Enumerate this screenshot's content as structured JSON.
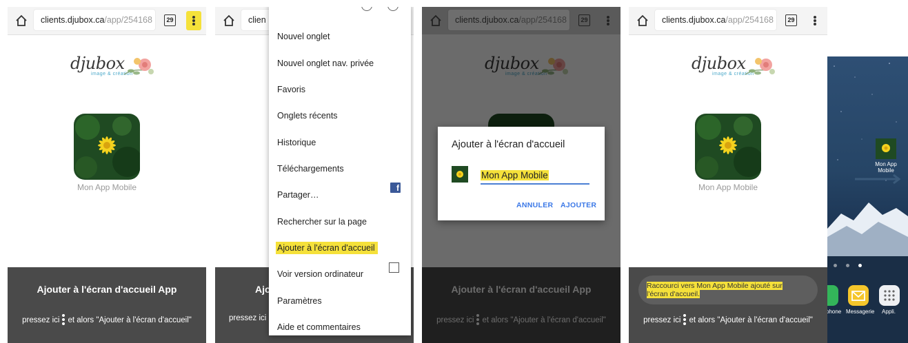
{
  "chrome": {
    "url_host": "clients.djubox.ca",
    "url_path": "/app/254168",
    "tabs_count": "29"
  },
  "page": {
    "logo_word": "djubox",
    "logo_tagline": "image & création",
    "app_name": "Mon App Mobile",
    "banner_title": "Ajouter à l'écran d'accueil App",
    "banner_instruction_prefix": "pressez ici",
    "banner_instruction_suffix": "et alors \"Ajouter à l'écran d'accueil\"",
    "banner_title_partial": "Ajo",
    "banner_url_partial": "clien"
  },
  "menu": {
    "items": [
      "Nouvel onglet",
      "Nouvel onglet nav. privée",
      "Favoris",
      "Onglets récents",
      "Historique",
      "Téléchargements",
      "Partager…",
      "Rechercher sur la page",
      "Ajouter à l'écran d'accueil",
      "Voir version ordinateur",
      "Paramètres",
      "Aide et commentaires"
    ],
    "highlighted": "Ajouter à l'écran d'accueil"
  },
  "dialog": {
    "title": "Ajouter à l'écran d'accueil",
    "input_value": "Mon App Mobile",
    "cancel_label": "ANNULER",
    "add_label": "AJOUTER"
  },
  "toast": {
    "text": "Raccourci vers Mon App Mobile ajouté sur l'écran d'accueil."
  },
  "homescreen": {
    "shortcut_label": "Mon App Mobile",
    "dock_labels": [
      "phone",
      "Messagerie",
      "Appli."
    ]
  },
  "colors": {
    "highlight": "#f5e13a",
    "banner_bg": "#4a4a4a",
    "dialog_accent": "#3b78e7"
  }
}
